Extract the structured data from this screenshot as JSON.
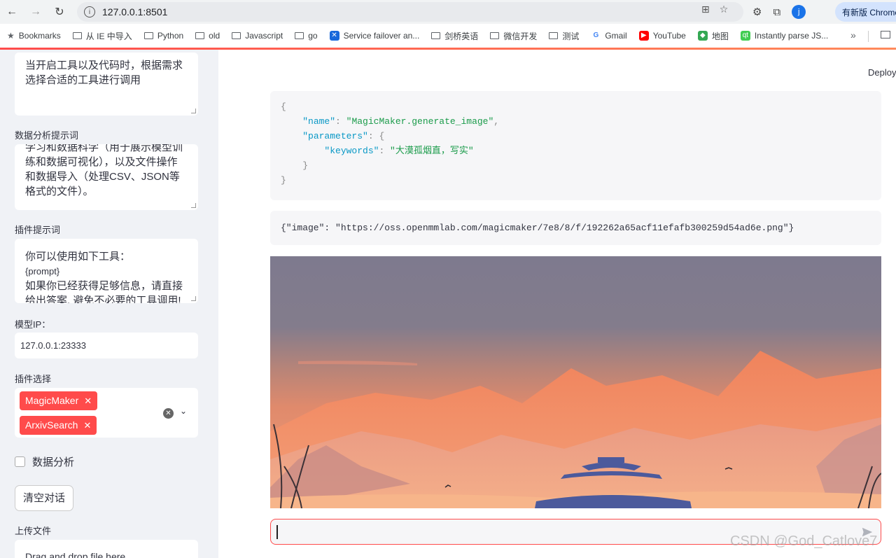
{
  "browser": {
    "url": "127.0.0.1:8501",
    "update_button": "有新版 Chrome",
    "avatar_letter": "j"
  },
  "bookmarks": [
    {
      "label": "Bookmarks",
      "icon": "star-icon"
    },
    {
      "label": "从 IE 中导入",
      "icon": "folder-icon"
    },
    {
      "label": "Python",
      "icon": "folder-icon"
    },
    {
      "label": "old",
      "icon": "folder-icon"
    },
    {
      "label": "Javascript",
      "icon": "folder-icon"
    },
    {
      "label": "go",
      "icon": "folder-icon"
    },
    {
      "label": "Service failover an...",
      "icon": "confluence-icon"
    },
    {
      "label": "剑桥英语",
      "icon": "folder-icon"
    },
    {
      "label": "微信开发",
      "icon": "folder-icon"
    },
    {
      "label": "测试",
      "icon": "folder-icon"
    },
    {
      "label": "Gmail",
      "icon": "google-icon"
    },
    {
      "label": "YouTube",
      "icon": "youtube-icon"
    },
    {
      "label": "地图",
      "icon": "maps-icon"
    },
    {
      "label": "Instantly parse JS...",
      "icon": "qt-icon"
    }
  ],
  "sidebar": {
    "system_prompt_text": "当开启工具以及代码时，根据需求选择合适的工具进行调用",
    "data_prompt_label": "数据分析提示词",
    "data_prompt_text": "学习和数据科学（用于展示模型训练和数据可视化），以及文件操作和数据导入（处理CSV、JSON等格式的文件）。",
    "plugin_prompt_label": "插件提示词",
    "plugin_prompt_lines": [
      "你可以使用如下工具：",
      "{prompt}",
      "如果你已经获得足够信息，请直接",
      "给出答案. 避免不必要的工具调用!"
    ],
    "model_ip_label": "模型IP：",
    "model_ip_value": "127.0.0.1:23333",
    "plugin_select_label": "插件选择",
    "plugins": [
      "MagicMaker",
      "ArxivSearch"
    ],
    "data_analysis_label": "数据分析",
    "clear_button": "清空对话",
    "upload_label": "上传文件",
    "upload_drop_text": "Drag and drop file here"
  },
  "main": {
    "deploy": "Deploy",
    "tool_call": {
      "open": "{",
      "name_key": "\"name\"",
      "name_val": "\"MagicMaker.generate_image\"",
      "params_key": "\"parameters\"",
      "kw_key": "\"keywords\"",
      "kw_val": "\"大漠孤烟直，写实\"",
      "inner_close": "}",
      "close": "}"
    },
    "tool_result": "{\"image\": \"https://oss.openmmlab.com/magicmaker/7e8/8/f/192262a65acf11efafb300259d54ad6e.png\"}"
  },
  "watermark": "CSDN @God_Catlove7"
}
